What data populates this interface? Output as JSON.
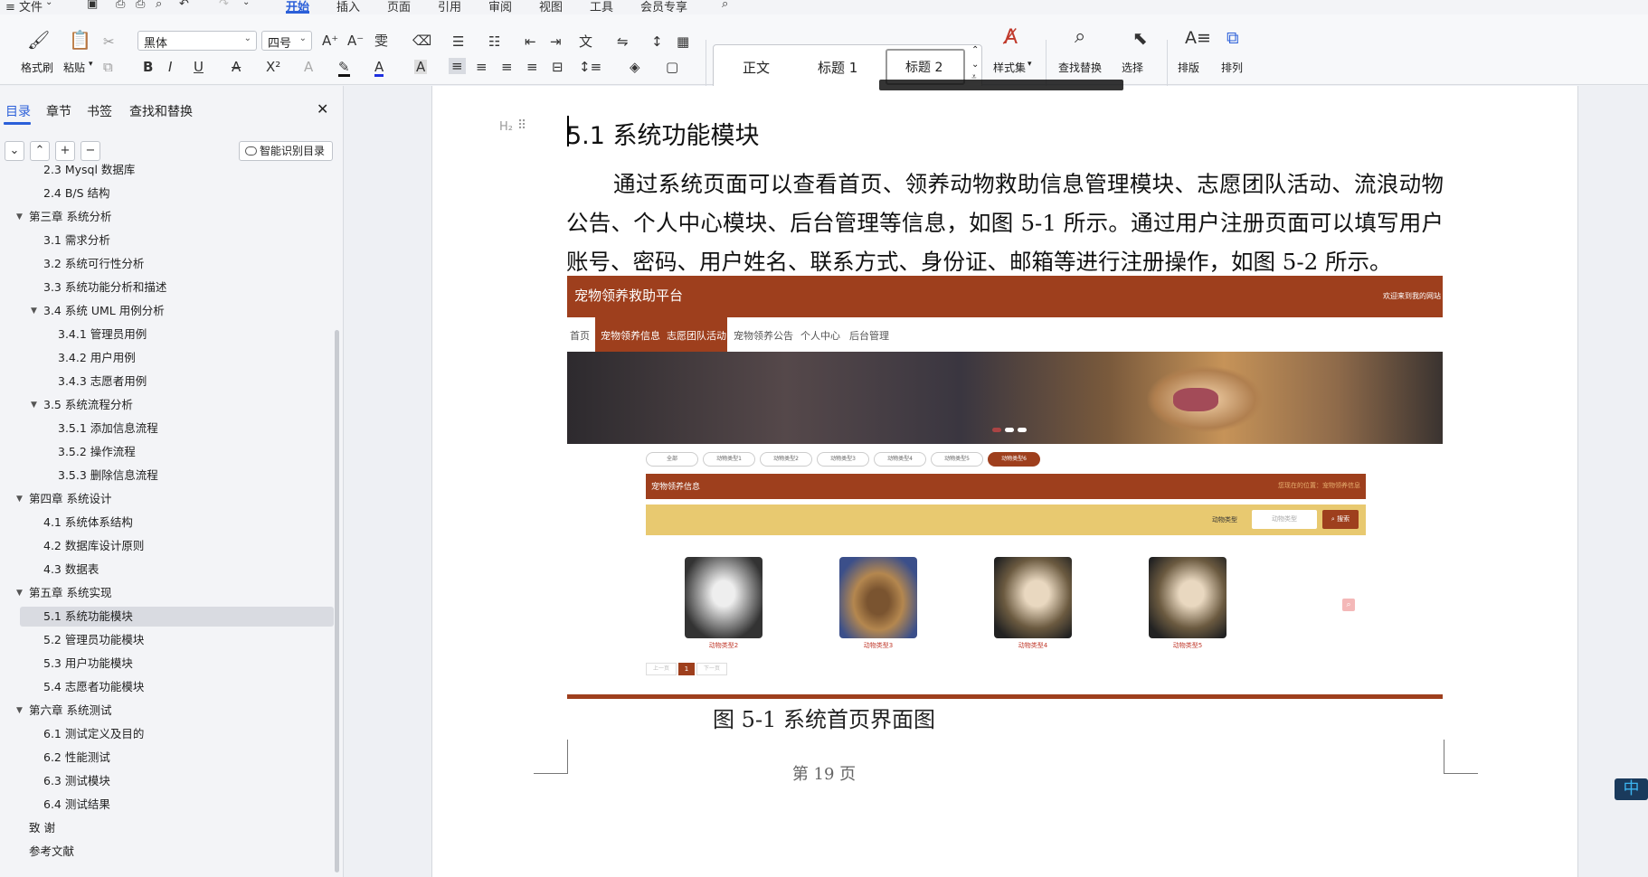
{
  "menubar": {
    "file": "≡ 文件",
    "tabs": [
      "开始",
      "插入",
      "页面",
      "引用",
      "审阅",
      "视图",
      "工具",
      "会员专享"
    ]
  },
  "ribbon": {
    "format_painter": "格式刷",
    "paste": "粘贴",
    "font_name": "黑体",
    "font_size": "四号",
    "style_normal": "正文",
    "style_h1": "标题 1",
    "style_h2": "标题 2",
    "style_set": "样式集",
    "find_replace": "查找替换",
    "select": "选择",
    "layout": "排版",
    "arrange": "排列"
  },
  "sidebar": {
    "tabs": [
      "目录",
      "章节",
      "书签",
      "查找和替换"
    ],
    "smart_toc": "智能识别目录",
    "items": [
      {
        "label": "2.3 Mysql 数据库",
        "level": 2
      },
      {
        "label": "2.4 B/S 结构",
        "level": 2
      },
      {
        "label": "第三章  系统分析",
        "level": 1,
        "expanded": true
      },
      {
        "label": "3.1  需求分析",
        "level": 2
      },
      {
        "label": "3.2  系统可行性分析",
        "level": 2
      },
      {
        "label": "3.3  系统功能分析和描述",
        "level": 2
      },
      {
        "label": "3.4 系统 UML 用例分析",
        "level": 2,
        "expanded": true
      },
      {
        "label": "3.4.1 管理员用例",
        "level": 3
      },
      {
        "label": "3.4.2 用户用例",
        "level": 3
      },
      {
        "label": "3.4.3 志愿者用例",
        "level": 3
      },
      {
        "label": "3.5 系统流程分析",
        "level": 2,
        "expanded": true
      },
      {
        "label": "3.5.1 添加信息流程",
        "level": 3
      },
      {
        "label": "3.5.2 操作流程",
        "level": 3
      },
      {
        "label": "3.5.3 删除信息流程",
        "level": 3
      },
      {
        "label": "第四章  系统设计",
        "level": 1,
        "expanded": true
      },
      {
        "label": "4.1  系统体系结构",
        "level": 2
      },
      {
        "label": "4.2  数据库设计原则",
        "level": 2
      },
      {
        "label": "4.3  数据表",
        "level": 2
      },
      {
        "label": "第五章  系统实现",
        "level": 1,
        "expanded": true
      },
      {
        "label": "5.1 系统功能模块",
        "level": 2,
        "selected": true
      },
      {
        "label": "5.2 管理员功能模块",
        "level": 2
      },
      {
        "label": "5.3 用户功能模块",
        "level": 2
      },
      {
        "label": "5.4 志愿者功能模块",
        "level": 2
      },
      {
        "label": "第六章    系统测试",
        "level": 1,
        "expanded": true
      },
      {
        "label": "6.1 测试定义及目的",
        "level": 2
      },
      {
        "label": "6.2 性能测试",
        "level": 2
      },
      {
        "label": "6.3 测试模块",
        "level": 2
      },
      {
        "label": "6.4 测试结果",
        "level": 2
      },
      {
        "label": "致  谢",
        "level": 1
      },
      {
        "label": "参考文献",
        "level": 1
      }
    ]
  },
  "document": {
    "heading_marker": "H₂",
    "heading": "5.1 系统功能模块",
    "paragraph": "通过系统页面可以查看首页、领养动物救助信息管理模块、志愿团队活动、流浪动物公告、个人中心模块、后台管理等信息，如图 5-1 所示。通过用户注册页面可以填写用户账号、密码、用户姓名、联系方式、身份证、邮箱等进行注册操作，如图 5-2 所示。",
    "caption": "图 5-1  系统首页界面图",
    "page_number": "第  19  页"
  },
  "figure": {
    "site_title": "宠物领养救助平台",
    "welcome": "欢迎来到我的网站",
    "nav": [
      "首页",
      "宠物领养信息",
      "志愿团队活动",
      "宠物领养公告",
      "个人中心",
      "后台管理"
    ],
    "categories": [
      "全部",
      "动物类型1",
      "动物类型2",
      "动物类型3",
      "动物类型4",
      "动物类型5",
      "动物类型6"
    ],
    "section_title": "宠物领养信息",
    "breadcrumb": "您现在的位置：宠物领养信息",
    "filter_label": "动物类型",
    "filter_placeholder": "动物类型",
    "search_btn": "搜索",
    "cards": [
      "动物类型2",
      "动物类型3",
      "动物类型4",
      "动物类型5"
    ],
    "pager": [
      "上一页",
      "1",
      "下一页"
    ],
    "brand_color": "#9e3f1d",
    "filter_bar_color": "#e8c970"
  }
}
